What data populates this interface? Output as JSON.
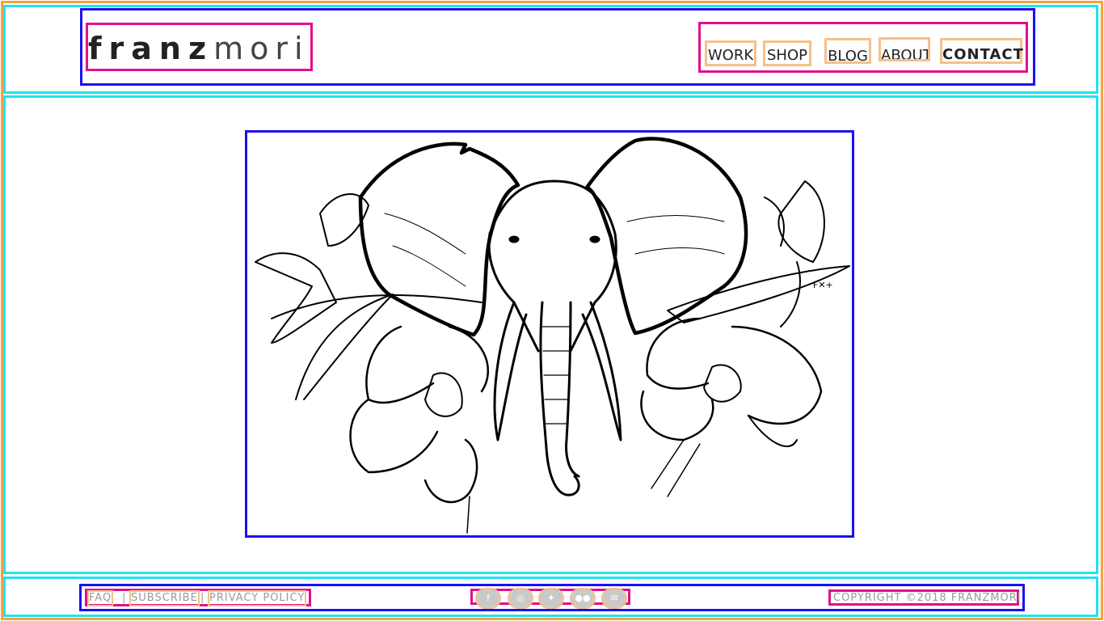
{
  "brand": {
    "name_bold": "franz",
    "name_light": "mori"
  },
  "nav": {
    "items": [
      {
        "label": "WORK"
      },
      {
        "label": "SHOP"
      },
      {
        "label": "BLOG"
      },
      {
        "label": "ABOUT"
      },
      {
        "label": "CONTACT",
        "active": true
      }
    ]
  },
  "main": {
    "artwork_icon": "elephant-orchid-illustration"
  },
  "footer": {
    "links": [
      {
        "label": "FAQ"
      },
      {
        "label": "SUBSCRIBE"
      },
      {
        "label": "PRIVACY POLICY"
      }
    ],
    "separator": "|",
    "social": [
      {
        "icon": "facebook-icon",
        "glyph": "f"
      },
      {
        "icon": "instagram-icon",
        "glyph": "◎"
      },
      {
        "icon": "twitter-icon",
        "glyph": "✦"
      },
      {
        "icon": "flickr-icon",
        "glyph": "●●"
      },
      {
        "icon": "email-icon",
        "glyph": "✉"
      }
    ],
    "copyright": "COPYRIGHT ©2018 FRANZMORI"
  },
  "colors": {
    "text": "#111111",
    "muted": "#9a9a9a",
    "social_bg": "#c9c9c9"
  }
}
